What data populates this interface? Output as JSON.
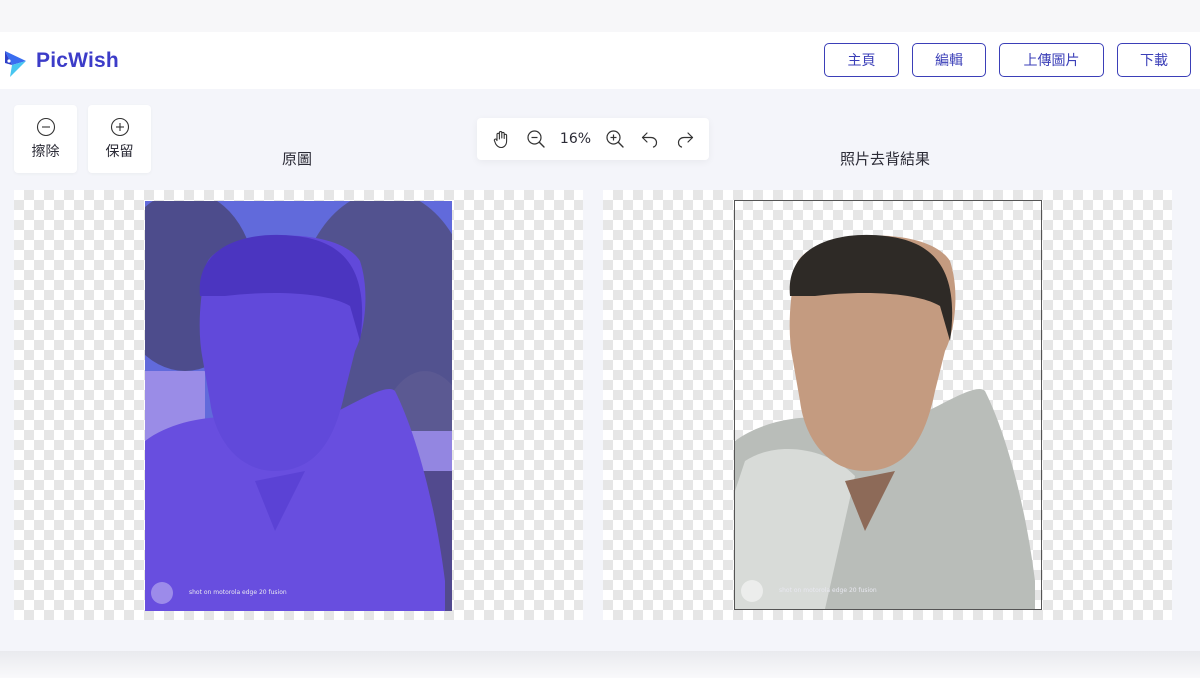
{
  "header": {
    "brand": "PicWish",
    "nav": [
      {
        "label": "主頁"
      },
      {
        "label": "編輯"
      },
      {
        "label": "上傳圖片"
      },
      {
        "label": "下載"
      }
    ]
  },
  "tools": {
    "erase_label": "擦除",
    "keep_label": "保留"
  },
  "zoom": {
    "value": "16%",
    "icons": [
      "hand-icon",
      "zoom-out-icon",
      "zoom-in-icon",
      "undo-icon",
      "redo-icon"
    ]
  },
  "panels": {
    "original_title": "原圖",
    "result_title": "照片去背結果"
  },
  "photo": {
    "watermark": "shot on motorola edge 20 fusion"
  },
  "colors": {
    "accent": "#3b3fb8",
    "brand": "#3c3cc8",
    "overlay": "#5a3ee0",
    "checker": "#e6e6e6"
  }
}
